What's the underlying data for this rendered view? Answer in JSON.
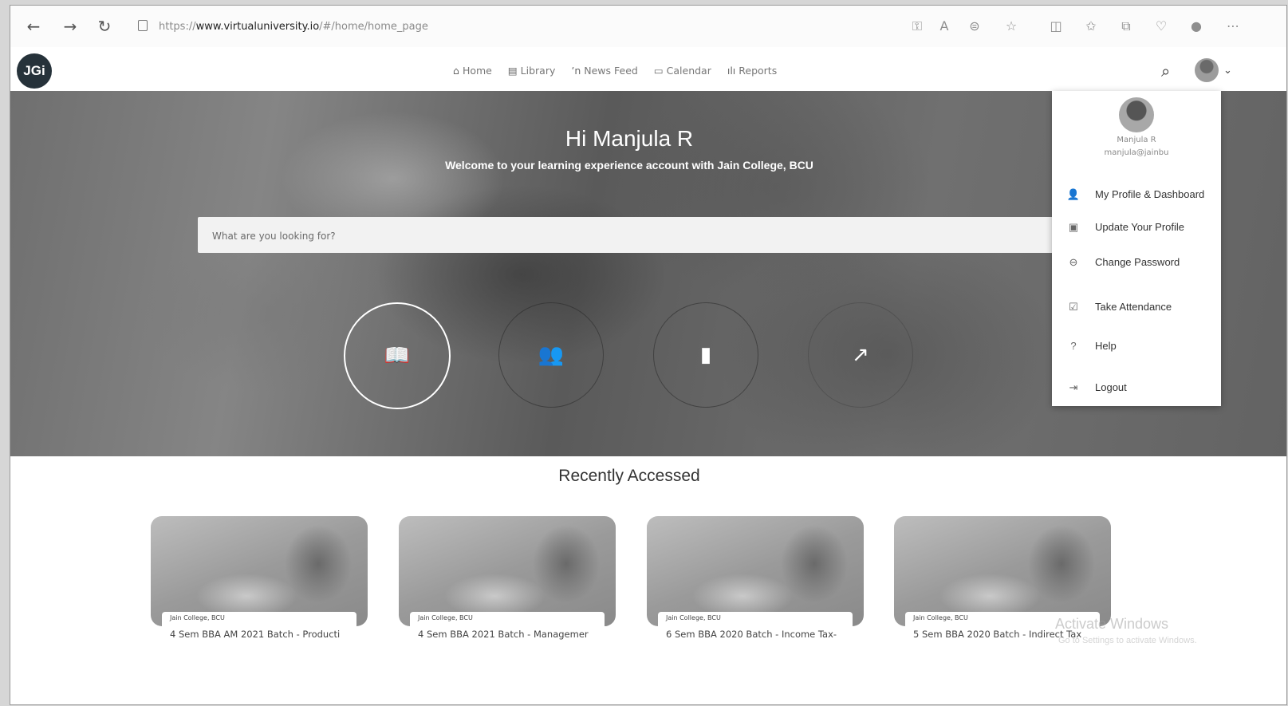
{
  "browser": {
    "url_scheme": "https://",
    "url_host": "www.virtualuniversity.io",
    "url_path": "/#/home/home_page"
  },
  "app": {
    "logo_text": "JGi",
    "nav": [
      {
        "label": "Home",
        "icon": "home-icon"
      },
      {
        "label": "Library",
        "icon": "book-icon"
      },
      {
        "label": "News Feed",
        "icon": "rss-icon"
      },
      {
        "label": "Calendar",
        "icon": "calendar-icon"
      },
      {
        "label": "Reports",
        "icon": "bar-chart-icon"
      }
    ]
  },
  "hero": {
    "greeting": "Hi Manjula R",
    "subtitle": "Welcome to your learning experience account with Jain College, BCU",
    "search_placeholder": "What are you looking for?"
  },
  "dropdown": {
    "name": "Manjula R",
    "email": "manjula@jainbu",
    "items": [
      {
        "label": "My Profile & Dashboard",
        "icon": "user-icon"
      },
      {
        "label": "Update Your Profile",
        "icon": "id-card-icon"
      },
      {
        "label": "Change Password",
        "icon": "key-icon"
      },
      {
        "label": "Take Attendance",
        "icon": "calendar-check-icon"
      },
      {
        "label": "Help",
        "icon": "help-icon"
      },
      {
        "label": "Logout",
        "icon": "logout-icon"
      }
    ]
  },
  "recent": {
    "title": "Recently Accessed",
    "cards": [
      {
        "org": "Jain College, BCU",
        "title": "4 Sem BBA AM 2021 Batch - Producti"
      },
      {
        "org": "Jain College, BCU",
        "title": "4 Sem BBA 2021 Batch - Managemer"
      },
      {
        "org": "Jain College, BCU",
        "title": "6 Sem BBA 2020 Batch - Income Tax-"
      },
      {
        "org": "Jain College, BCU",
        "title": "5 Sem BBA 2020 Batch - Indirect Tax"
      }
    ]
  },
  "watermark": {
    "line1": "Activate Windows",
    "line2": "Go to Settings to activate Windows."
  }
}
